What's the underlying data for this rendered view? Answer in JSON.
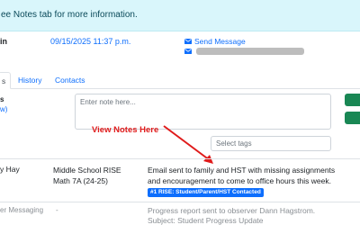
{
  "banner": {
    "text": "ee Notes tab for more information."
  },
  "contact": {
    "label": "in",
    "timestamp": "09/15/2025 11:37 p.m.",
    "send_message": "Send Message"
  },
  "tabs": [
    {
      "label": "s"
    },
    {
      "label": "History"
    },
    {
      "label": "Contacts"
    }
  ],
  "add_note": {
    "label": "s",
    "sublabel": "w)",
    "placeholder": "Enter note here...",
    "tags_placeholder": "Select tags"
  },
  "annotation": {
    "text": "View Notes Here",
    "color": "#e01b1b"
  },
  "rows": [
    {
      "name": "y Hay",
      "course": "Middle School RISE Math 7A (24-25)",
      "body": "Email sent to family and HST with missing assignments and encouragement to come to office hours this week.",
      "tag": "#1 RISE: Student/Parent/HST Contacted"
    },
    {
      "name": "er Messaging",
      "course": "-",
      "body_line1": "Progress report sent to observer Dann Hagstrom.",
      "body_line2": "Subject: Student Progress Update"
    }
  ],
  "colors": {
    "link": "#0d6efd",
    "banner_bg": "#d9f6fb",
    "button_green": "#198754",
    "badge": "#0d6efd"
  }
}
